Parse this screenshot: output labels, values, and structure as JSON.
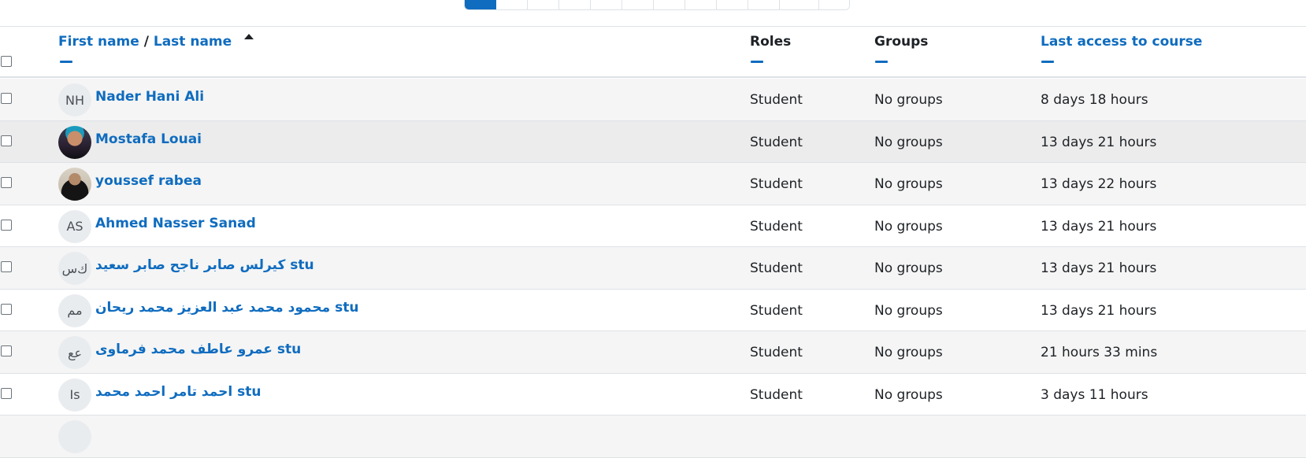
{
  "pagination": {
    "pages": [
      "",
      "",
      "",
      "",
      "",
      "",
      "",
      "",
      "",
      "",
      "",
      "",
      ""
    ],
    "active_index": 0
  },
  "table": {
    "headers": {
      "first_name": "First name",
      "separator": "/",
      "last_name": "Last name",
      "roles": "Roles",
      "groups": "Groups",
      "last_access": "Last access to course"
    },
    "rows": [
      {
        "initials": "NH",
        "name": "Nader Hani Ali",
        "role": "Student",
        "groups": "No groups",
        "last_access": "8 days 18 hours"
      },
      {
        "initials": "",
        "name": "Mostafa Louai",
        "role": "Student",
        "groups": "No groups",
        "last_access": "13 days 21 hours"
      },
      {
        "initials": "",
        "name": "youssef rabea",
        "role": "Student",
        "groups": "No groups",
        "last_access": "13 days 22 hours"
      },
      {
        "initials": "AS",
        "name": "Ahmed Nasser Sanad",
        "role": "Student",
        "groups": "No groups",
        "last_access": "13 days 21 hours"
      },
      {
        "initials": "ﻙﺱ",
        "name": "كيرلس صابر ناجح صابر سعيد stu",
        "role": "Student",
        "groups": "No groups",
        "last_access": "13 days 21 hours"
      },
      {
        "initials": "مم",
        "name": "محمود محمد عبد العزيز محمد ريحان stu",
        "role": "Student",
        "groups": "No groups",
        "last_access": "13 days 21 hours"
      },
      {
        "initials": "عع",
        "name": "عمرو عاطف محمد فرماوى stu",
        "role": "Student",
        "groups": "No groups",
        "last_access": "21 hours 33 mins"
      },
      {
        "initials": "Is",
        "name": "احمد تامر احمد محمد stu",
        "role": "Student",
        "groups": "No groups",
        "last_access": "3 days 11 hours"
      }
    ]
  },
  "colors": {
    "link": "#0f6cbf",
    "text": "#1d2125",
    "row_stripe": "#f5f5f5",
    "row_hover": "#ececec",
    "border": "#dee2e6"
  }
}
